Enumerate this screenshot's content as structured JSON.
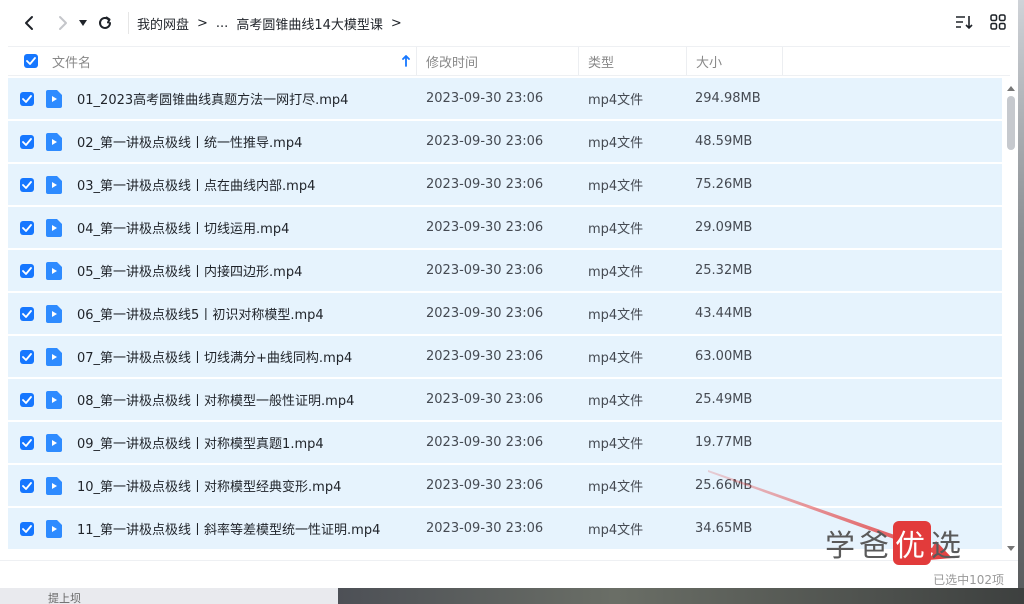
{
  "toolbar": {
    "breadcrumbs": [
      "我的网盘",
      "...",
      "高考圆锥曲线14大模型课"
    ]
  },
  "columns": {
    "name": "文件名",
    "modified": "修改时间",
    "type": "类型",
    "size": "大小"
  },
  "files": [
    {
      "name": "01_2023高考圆锥曲线真题方法一网打尽.mp4",
      "modified": "2023-09-30 23:06",
      "type": "mp4文件",
      "size": "294.98MB"
    },
    {
      "name": "02_第一讲极点极线丨统一性推导.mp4",
      "modified": "2023-09-30 23:06",
      "type": "mp4文件",
      "size": "48.59MB"
    },
    {
      "name": "03_第一讲极点极线丨点在曲线内部.mp4",
      "modified": "2023-09-30 23:06",
      "type": "mp4文件",
      "size": "75.26MB"
    },
    {
      "name": "04_第一讲极点极线丨切线运用.mp4",
      "modified": "2023-09-30 23:06",
      "type": "mp4文件",
      "size": "29.09MB"
    },
    {
      "name": "05_第一讲极点极线丨内接四边形.mp4",
      "modified": "2023-09-30 23:06",
      "type": "mp4文件",
      "size": "25.32MB"
    },
    {
      "name": "06_第一讲极点极线5丨初识对称模型.mp4",
      "modified": "2023-09-30 23:06",
      "type": "mp4文件",
      "size": "43.44MB"
    },
    {
      "name": "07_第一讲极点极线丨切线满分+曲线同构.mp4",
      "modified": "2023-09-30 23:06",
      "type": "mp4文件",
      "size": "63.00MB"
    },
    {
      "name": "08_第一讲极点极线丨对称模型一般性证明.mp4",
      "modified": "2023-09-30 23:06",
      "type": "mp4文件",
      "size": "25.49MB"
    },
    {
      "name": "09_第一讲极点极线丨对称模型真题1.mp4",
      "modified": "2023-09-30 23:06",
      "type": "mp4文件",
      "size": "19.77MB"
    },
    {
      "name": "10_第一讲极点极线丨对称模型经典变形.mp4",
      "modified": "2023-09-30 23:06",
      "type": "mp4文件",
      "size": "25.66MB"
    },
    {
      "name": "11_第一讲极点极线丨斜率等差模型统一性证明.mp4",
      "modified": "2023-09-30 23:06",
      "type": "mp4文件",
      "size": "34.65MB"
    }
  ],
  "footer": {
    "selected_count": "已选中102项"
  },
  "watermark": {
    "part1": "学爸",
    "part2": "优",
    "part3": "选"
  },
  "background": {
    "ghost_text": "提上坝"
  },
  "colors": {
    "accent": "#1677ff",
    "row_selected": "#e6f3fd",
    "file_icon": "#2e8bff"
  }
}
